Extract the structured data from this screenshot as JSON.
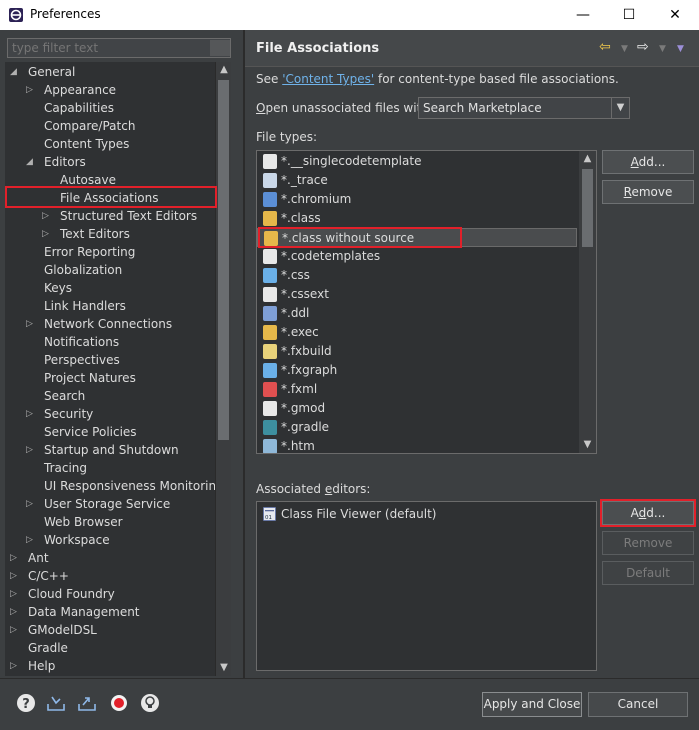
{
  "window": {
    "title": "Preferences",
    "minimize": "—",
    "maximize": "☐",
    "close": "✕"
  },
  "filter": {
    "placeholder": "type filter text"
  },
  "tree": [
    {
      "label": "General",
      "level": 0,
      "expander": "open"
    },
    {
      "label": "Appearance",
      "level": 1,
      "expander": "closed"
    },
    {
      "label": "Capabilities",
      "level": 1,
      "expander": "none"
    },
    {
      "label": "Compare/Patch",
      "level": 1,
      "expander": "none"
    },
    {
      "label": "Content Types",
      "level": 1,
      "expander": "none"
    },
    {
      "label": "Editors",
      "level": 1,
      "expander": "open"
    },
    {
      "label": "Autosave",
      "level": 2,
      "expander": "none"
    },
    {
      "label": "File Associations",
      "level": 2,
      "expander": "none",
      "selected": true
    },
    {
      "label": "Structured Text Editors",
      "level": 2,
      "expander": "closed"
    },
    {
      "label": "Text Editors",
      "level": 2,
      "expander": "closed"
    },
    {
      "label": "Error Reporting",
      "level": 1,
      "expander": "none"
    },
    {
      "label": "Globalization",
      "level": 1,
      "expander": "none"
    },
    {
      "label": "Keys",
      "level": 1,
      "expander": "none"
    },
    {
      "label": "Link Handlers",
      "level": 1,
      "expander": "none"
    },
    {
      "label": "Network Connections",
      "level": 1,
      "expander": "closed"
    },
    {
      "label": "Notifications",
      "level": 1,
      "expander": "none"
    },
    {
      "label": "Perspectives",
      "level": 1,
      "expander": "none"
    },
    {
      "label": "Project Natures",
      "level": 1,
      "expander": "none"
    },
    {
      "label": "Search",
      "level": 1,
      "expander": "none"
    },
    {
      "label": "Security",
      "level": 1,
      "expander": "closed"
    },
    {
      "label": "Service Policies",
      "level": 1,
      "expander": "none"
    },
    {
      "label": "Startup and Shutdown",
      "level": 1,
      "expander": "closed"
    },
    {
      "label": "Tracing",
      "level": 1,
      "expander": "none"
    },
    {
      "label": "UI Responsiveness Monitoring",
      "level": 1,
      "expander": "none"
    },
    {
      "label": "User Storage Service",
      "level": 1,
      "expander": "closed"
    },
    {
      "label": "Web Browser",
      "level": 1,
      "expander": "none"
    },
    {
      "label": "Workspace",
      "level": 1,
      "expander": "closed"
    },
    {
      "label": "Ant",
      "level": 0,
      "expander": "closed"
    },
    {
      "label": "C/C++",
      "level": 0,
      "expander": "closed"
    },
    {
      "label": "Cloud Foundry",
      "level": 0,
      "expander": "closed"
    },
    {
      "label": "Data Management",
      "level": 0,
      "expander": "closed"
    },
    {
      "label": "GModelDSL",
      "level": 0,
      "expander": "closed"
    },
    {
      "label": "Gradle",
      "level": 0,
      "expander": "none"
    },
    {
      "label": "Help",
      "level": 0,
      "expander": "closed"
    }
  ],
  "page": {
    "title": "File Associations",
    "see_prefix": "See ",
    "see_link": "'Content Types'",
    "see_suffix": " for content-type based file associations.",
    "open_label_u": "O",
    "open_label_rest": "pen unassociated files with:",
    "open_value": "Search Marketplace",
    "file_types_label": "File types:",
    "file_types": [
      {
        "name": "*.__singlecodetemplate",
        "icon": "doc-icon",
        "color": "#e8e8e8"
      },
      {
        "name": "*._trace",
        "icon": "trace-icon",
        "color": "#c9d7e8"
      },
      {
        "name": "*.chromium",
        "icon": "chromium-icon",
        "color": "#5b8fd6"
      },
      {
        "name": "*.class",
        "icon": "class-icon",
        "color": "#e6b84a"
      },
      {
        "name": "*.class without source",
        "icon": "class-nosource-icon",
        "color": "#e6b84a",
        "selected": true
      },
      {
        "name": "*.codetemplates",
        "icon": "doc-icon",
        "color": "#e8e8e8"
      },
      {
        "name": "*.css",
        "icon": "css-icon",
        "color": "#6ab0e8"
      },
      {
        "name": "*.cssext",
        "icon": "doc-icon",
        "color": "#e8e8e8"
      },
      {
        "name": "*.ddl",
        "icon": "ddl-icon",
        "color": "#7f9fd6"
      },
      {
        "name": "*.exec",
        "icon": "exec-icon",
        "color": "#e6b84a"
      },
      {
        "name": "*.fxbuild",
        "icon": "fxbuild-icon",
        "color": "#e8d27a"
      },
      {
        "name": "*.fxgraph",
        "icon": "fxgraph-icon",
        "color": "#6ab0e8"
      },
      {
        "name": "*.fxml",
        "icon": "fxml-icon",
        "color": "#e05050"
      },
      {
        "name": "*.gmod",
        "icon": "doc-icon",
        "color": "#e8e8e8"
      },
      {
        "name": "*.gradle",
        "icon": "gradle-icon",
        "color": "#3d8f9f"
      },
      {
        "name": "*.htm",
        "icon": "globe-icon",
        "color": "#8fb8d8"
      }
    ],
    "add_label_u": "A",
    "add_label_rest": "dd...",
    "remove_label_u": "R",
    "remove_label_rest": "emove",
    "assoc_label_prefix": "Associated ",
    "assoc_label_u": "e",
    "assoc_label_rest": "ditors:",
    "editors": [
      {
        "name": "Class File Viewer (default)",
        "icon": "class-viewer-icon"
      }
    ],
    "assoc_add_label_u": "d",
    "assoc_add_prefix": "A",
    "assoc_add_rest": "d...",
    "assoc_remove_label": "Remove",
    "assoc_default_label": "Default"
  },
  "footer": {
    "apply_close": "Apply and Close",
    "cancel": "Cancel"
  },
  "colors": {
    "background": "#3c3f41",
    "highlight": "#e2202a",
    "link": "#6fb2e9",
    "nav_arrow": "#f2c94c"
  }
}
